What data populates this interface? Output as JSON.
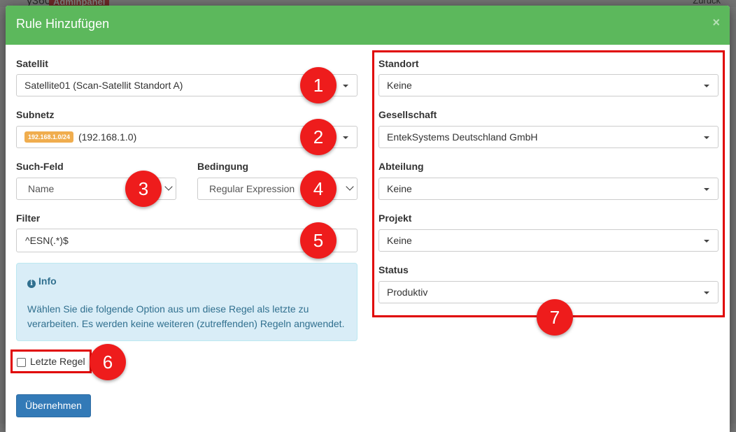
{
  "background": {
    "brand_fragment": "y360",
    "badge": "Adminpanel",
    "back_link": "Zurück"
  },
  "modal": {
    "title": "Rule Hinzufügen",
    "close_symbol": "×"
  },
  "left": {
    "satellit": {
      "label": "Satellit",
      "value": "Satellite01 (Scan-Satellit Standort A)"
    },
    "subnetz": {
      "label": "Subnetz",
      "badge": "192.168.1.0/24",
      "value": "(192.168.1.0)"
    },
    "such_feld": {
      "label": "Such-Feld",
      "value": "Name"
    },
    "bedingung": {
      "label": "Bedingung",
      "value": "Regular Expression"
    },
    "filter": {
      "label": "Filter",
      "value": "^ESN(.*)$"
    },
    "info": {
      "title": "Info",
      "text": "Wählen Sie die folgende Option aus um diese Regel als letzte zu verarbeiten. Es werden keine weiteren (zutreffenden) Regeln angwendet."
    },
    "letzte_regel": {
      "label": "Letzte Regel",
      "checked": false
    },
    "submit_label": "Übernehmen"
  },
  "right": {
    "standort": {
      "label": "Standort",
      "value": "Keine"
    },
    "gesellschaft": {
      "label": "Gesellschaft",
      "value": "EntekSystems Deutschland GmbH"
    },
    "abteilung": {
      "label": "Abteilung",
      "value": "Keine"
    },
    "projekt": {
      "label": "Projekt",
      "value": "Keine"
    },
    "status": {
      "label": "Status",
      "value": "Produktiv"
    }
  },
  "markers": [
    "1",
    "2",
    "3",
    "4",
    "5",
    "6",
    "7"
  ],
  "colors": {
    "header_green": "#5cb85c",
    "primary_blue": "#337ab7",
    "badge_orange": "#f0ad4e",
    "annotation_red": "#ee1c1c",
    "info_bg": "#d9edf7"
  },
  "icons": {
    "info": "info-circle-icon",
    "close": "close-icon",
    "dropdown": "caret-down-icon"
  }
}
